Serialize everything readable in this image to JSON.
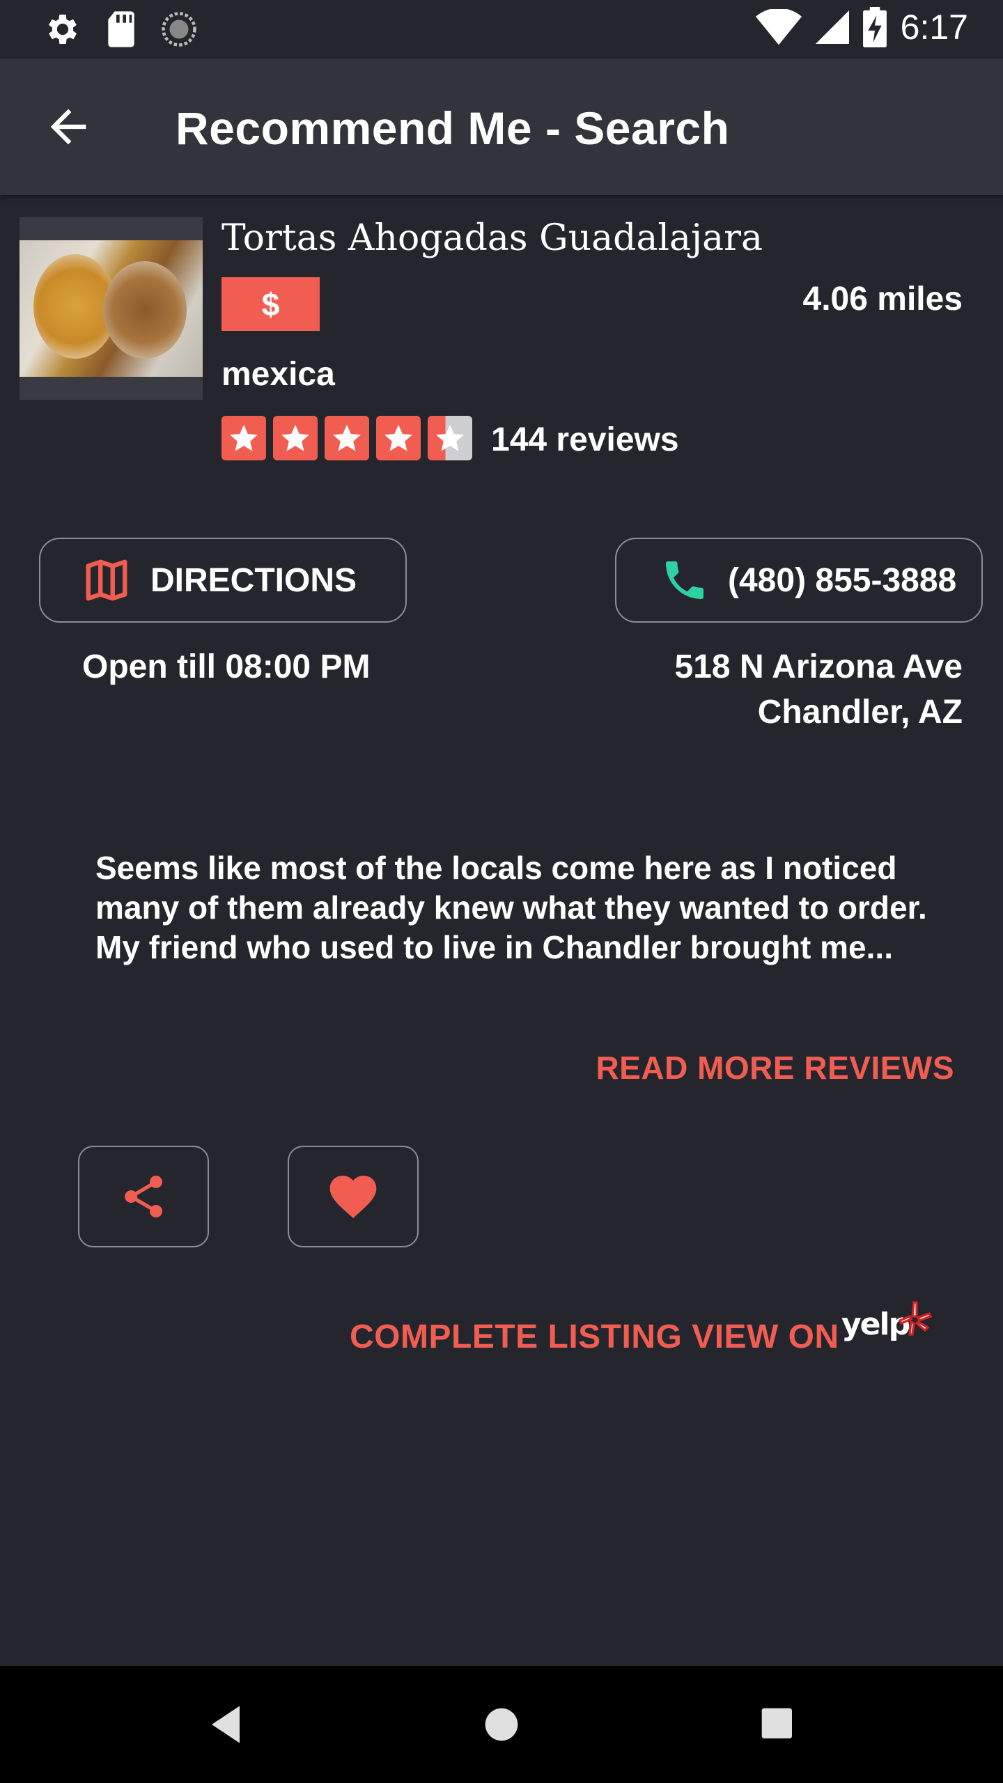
{
  "status_bar": {
    "time": "6:17",
    "left_icons": [
      "settings-icon",
      "sd-card-icon",
      "sync-icon"
    ],
    "right_icons": [
      "wifi-icon",
      "signal-icon",
      "battery-charging-icon"
    ]
  },
  "app_bar": {
    "title": "Recommend Me - Search",
    "back_icon": "arrow-back-icon"
  },
  "listing": {
    "name": "Tortas Ahogadas Guadalajara",
    "price": "$",
    "distance": "4.06 miles",
    "category": "mexica",
    "rating": 4.5,
    "rating_max": 5,
    "review_count": "144 reviews",
    "photo_icon": "food-photo"
  },
  "actions": {
    "directions_label": "DIRECTIONS",
    "directions_icon": "map-icon",
    "phone_label": "(480) 855-3888",
    "phone_icon": "phone-icon",
    "open_hours": "Open till 08:00 PM",
    "address_line1": "518 N Arizona Ave",
    "address_line2": "Chandler, AZ"
  },
  "review": {
    "snippet": "Seems like most of the locals come here as I noticed many of them already knew what they wanted to order. My friend who used to live in Chandler brought me...",
    "read_more_label": "READ MORE REVIEWS"
  },
  "buttons": {
    "share_icon": "share-icon",
    "favorite_icon": "heart-icon"
  },
  "footer": {
    "complete_listing_label": "COMPLETE LISTING VIEW ON",
    "yelp_logo_text": "yelp"
  },
  "colors": {
    "background": "#25262d",
    "app_bar": "#32333b",
    "accent": "#f25d52",
    "phone_icon": "#2ed1a0"
  },
  "nav_bar": {
    "icons": [
      "back-triangle-icon",
      "home-circle-icon",
      "recents-square-icon"
    ]
  }
}
